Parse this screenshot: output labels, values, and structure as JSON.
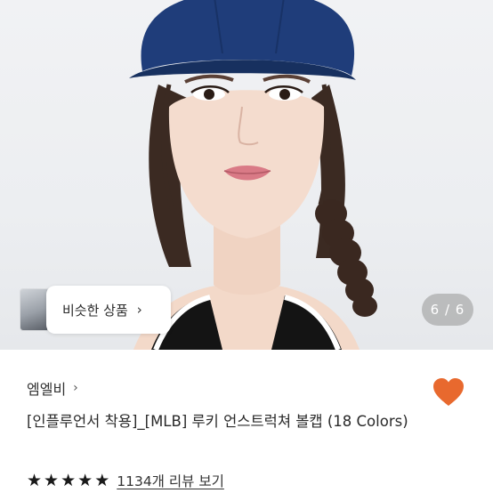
{
  "gallery": {
    "similar_products_label": "비슷한 상품",
    "similar_chevron": "›",
    "counter": "6 / 6"
  },
  "product": {
    "shop_name": "엠엘비",
    "shop_chevron": "›",
    "title": "[인플루언서 착용]_[MLB] 루키 언스트럭쳐 볼캡 (18 Colors)",
    "rating_stars": 5,
    "review_link": "1134개 리뷰 보기",
    "wishlist_icon": "heart-icon"
  },
  "colors": {
    "heart": "#e8692e",
    "cap": "#1f3d7a"
  }
}
